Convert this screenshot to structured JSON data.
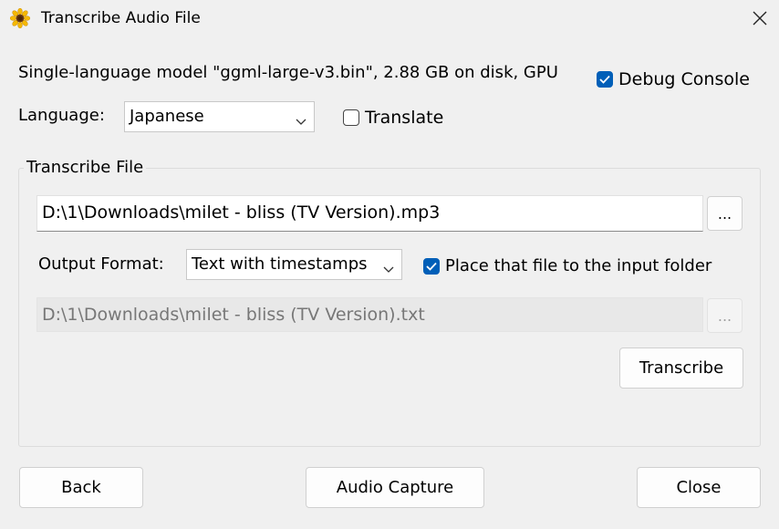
{
  "window": {
    "title": "Transcribe Audio File",
    "app_icon": "sunflower-icon",
    "close_icon": "close-icon"
  },
  "model_info": "Single-language model \"ggml-large-v3.bin\", 2.88 GB on disk, GPU",
  "debug_console": {
    "label": "Debug Console",
    "checked": true
  },
  "language": {
    "label": "Language:",
    "value": "Japanese"
  },
  "translate": {
    "label": "Translate",
    "checked": false
  },
  "transcribe_group": {
    "label": "Transcribe File",
    "input_file": "D:\\1\\Downloads\\milet - bliss (TV Version).mp3",
    "browse_input_label": "...",
    "output_format_label": "Output Format:",
    "output_format_value": "Text with timestamps",
    "place_in_input_folder": {
      "label": "Place that file to the input folder",
      "checked": true
    },
    "output_file": "D:\\1\\Downloads\\milet - bliss (TV Version).txt",
    "browse_output_label": "...",
    "transcribe_button": "Transcribe"
  },
  "footer": {
    "back": "Back",
    "audio_capture": "Audio Capture",
    "close": "Close"
  },
  "colors": {
    "accent": "#005fb8",
    "background": "#f0f0f0"
  }
}
